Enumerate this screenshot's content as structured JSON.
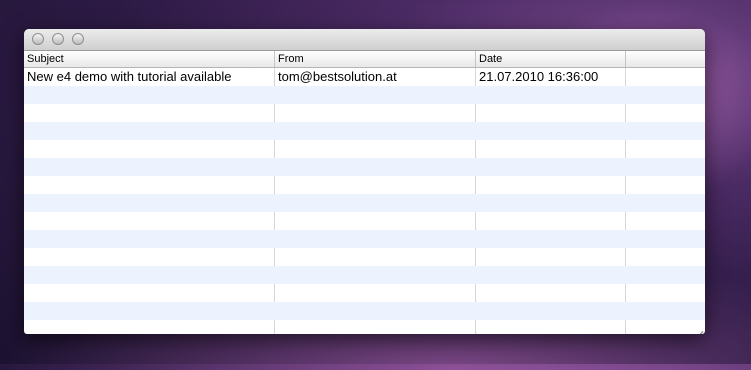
{
  "columns": [
    {
      "label": "Subject"
    },
    {
      "label": "From"
    },
    {
      "label": "Date"
    },
    {
      "label": ""
    }
  ],
  "rows": [
    {
      "subject": "New e4 demo with tutorial available",
      "from": "tom@bestsolution.at",
      "date": "21.07.2010 16:36:00"
    }
  ],
  "empty_row_count": 13
}
